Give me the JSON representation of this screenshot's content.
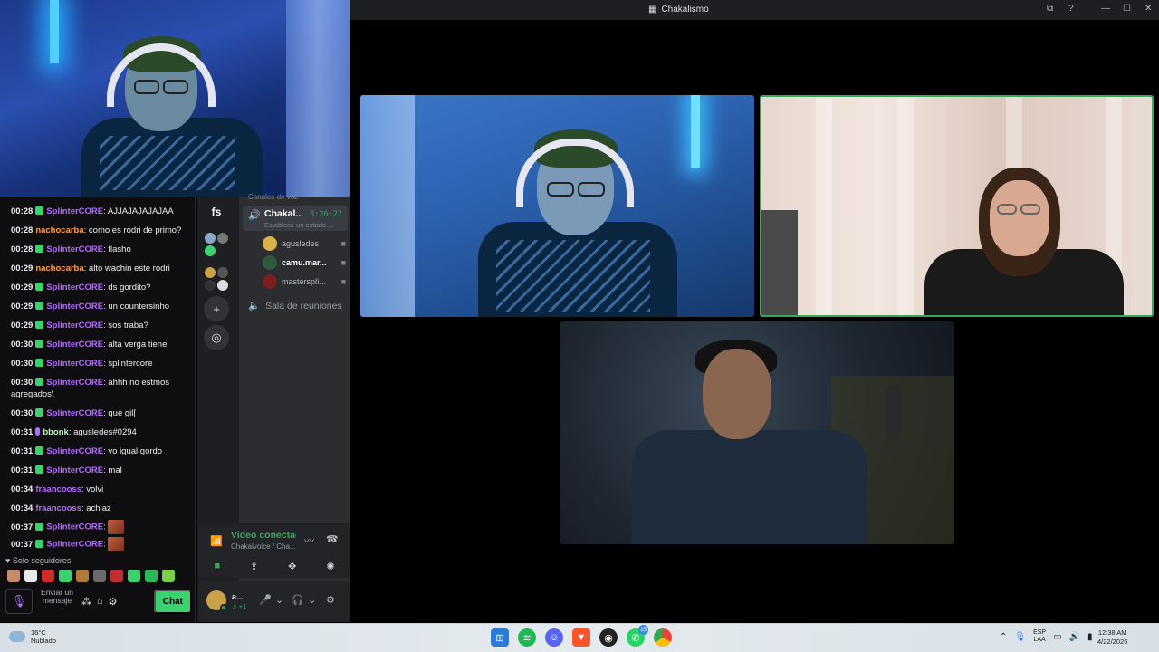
{
  "chat": {
    "messages": [
      {
        "time": "00:28",
        "user": "SplinterCORE",
        "color": "purple",
        "badge": "green",
        "text": ": AJJAJAJAJAJAA"
      },
      {
        "time": "00:28",
        "user": "nachocarba",
        "color": "orange",
        "badge": "",
        "text": ": como es rodri de primo?"
      },
      {
        "time": "00:28",
        "user": "SplinterCORE",
        "color": "purple",
        "badge": "green",
        "text": ": flasho"
      },
      {
        "time": "00:29",
        "user": "nachocarba",
        "color": "orange",
        "badge": "",
        "text": ": alto wachin este rodri"
      },
      {
        "time": "00:29",
        "user": "SplinterCORE",
        "color": "purple",
        "badge": "green",
        "text": ": ds gordito?"
      },
      {
        "time": "00:29",
        "user": "SplinterCORE",
        "color": "purple",
        "badge": "green",
        "text": ": un countersinho"
      },
      {
        "time": "00:29",
        "user": "SplinterCORE",
        "color": "purple",
        "badge": "green",
        "text": ": sos traba?"
      },
      {
        "time": "00:30",
        "user": "SplinterCORE",
        "color": "purple",
        "badge": "green",
        "text": ": alta verga tiene"
      },
      {
        "time": "00:30",
        "user": "SplinterCORE",
        "color": "purple",
        "badge": "green",
        "text": ": splintercore"
      },
      {
        "time": "00:30",
        "user": "SplinterCORE",
        "color": "purple",
        "badge": "green",
        "text": ": ahhh no estmos agregados\\"
      },
      {
        "time": "00:30",
        "user": "SplinterCORE",
        "color": "purple",
        "badge": "green",
        "text": ": que gil["
      },
      {
        "time": "00:31",
        "user": "bbonk",
        "color": "teal",
        "badge": "purple",
        "text": ": agusledes#0294"
      },
      {
        "time": "00:31",
        "user": "SplinterCORE",
        "color": "purple",
        "badge": "green",
        "text": ": yo igual gordo"
      },
      {
        "time": "00:31",
        "user": "SplinterCORE",
        "color": "purple",
        "badge": "green",
        "text": ": mal"
      },
      {
        "time": "00:34",
        "user": "fraancooss",
        "color": "purple",
        "badge": "",
        "text": ": volvi"
      },
      {
        "time": "00:34",
        "user": "fraancooss",
        "color": "purple",
        "badge": "",
        "text": ": achiaz"
      },
      {
        "time": "00:37",
        "user": "SplinterCORE",
        "color": "purple",
        "badge": "green",
        "text": ":",
        "emote": true
      },
      {
        "time": "00:37",
        "user": "SplinterCORE",
        "color": "purple",
        "badge": "green",
        "text": ":",
        "emote": true
      }
    ],
    "followers_only": "Solo seguidores",
    "input_placeholder": "Enviar un mensaje",
    "chat_button": "Chat"
  },
  "discord": {
    "server_label": "fs",
    "channels_header": "Canales de voz",
    "voice_channel": {
      "name": "Chakal...",
      "timer": "3:26:27",
      "status": "Establece un estado ..."
    },
    "members": [
      {
        "name": "agusledes",
        "bold": false,
        "avatar_color": "#d9b24a"
      },
      {
        "name": "camu.mar...",
        "bold": true,
        "avatar_color": "#2f5b3a"
      },
      {
        "name": "mastersplì...",
        "bold": false,
        "avatar_color": "#7a1e1e"
      }
    ],
    "second_channel": "Sala de reuniones",
    "voice_panel": {
      "title": "Video conectado",
      "subtitle": "Chakalvoice / Cha..."
    },
    "user": {
      "name": "a...",
      "sub": "♫ +1"
    }
  },
  "call_window": {
    "title": "Chakalismo",
    "speaking_color": "#3ba55c"
  },
  "taskbar": {
    "weather_temp": "16°C",
    "weather_desc": "Nublado",
    "whatsapp_badge": "15",
    "lang_top": "ESP",
    "lang_bottom": "LAA",
    "time": "12:38 AM",
    "date": "4/22/2026"
  }
}
